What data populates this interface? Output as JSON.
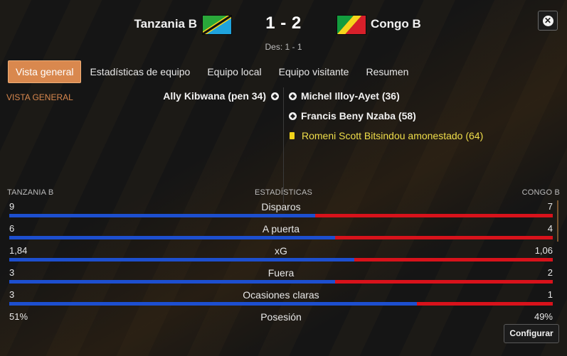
{
  "match": {
    "home_team": "Tanzania B",
    "away_team": "Congo B",
    "score": "1 - 2",
    "halftime": "Des: 1 - 1"
  },
  "tabs": [
    {
      "label": "Vista general",
      "active": true
    },
    {
      "label": "Estadísticas de equipo",
      "active": false
    },
    {
      "label": "Equipo local",
      "active": false
    },
    {
      "label": "Equipo visitante",
      "active": false
    },
    {
      "label": "Resumen",
      "active": false
    }
  ],
  "section_label": "VISTA GENERAL",
  "events": {
    "home": [
      {
        "text": "Ally Kibwana (pen 34)",
        "icon": "football-icon"
      }
    ],
    "away": [
      {
        "text": "Michel Illoy-Ayet (36)",
        "icon": "football-icon"
      },
      {
        "text": "Francis Beny Nzaba (58)",
        "icon": "football-icon"
      },
      {
        "text": "Romeni Scott Bitsindou amonestado (64)",
        "icon": "yellow-card-icon"
      }
    ]
  },
  "stats": {
    "home_label": "TANZANIA B",
    "title": "ESTADÍSTICAS",
    "away_label": "CONGO B",
    "rows": [
      {
        "label": "Disparos",
        "home": "9",
        "away": "7",
        "home_share": 0.5625
      },
      {
        "label": "A puerta",
        "home": "6",
        "away": "4",
        "home_share": 0.6
      },
      {
        "label": "xG",
        "home": "1,84",
        "away": "1,06",
        "home_share": 0.6345
      },
      {
        "label": "Fuera",
        "home": "3",
        "away": "2",
        "home_share": 0.6
      },
      {
        "label": "Ocasiones claras",
        "home": "3",
        "away": "1",
        "home_share": 0.75
      },
      {
        "label": "Posesión",
        "home": "51%",
        "away": "49%",
        "home_share": 0.51
      }
    ]
  },
  "config_button": "Configurar",
  "colors": {
    "accent": "#d9884e",
    "home_bar": "#1d4fcf",
    "away_bar": "#d8121b",
    "booking_text": "#f0de4a"
  }
}
